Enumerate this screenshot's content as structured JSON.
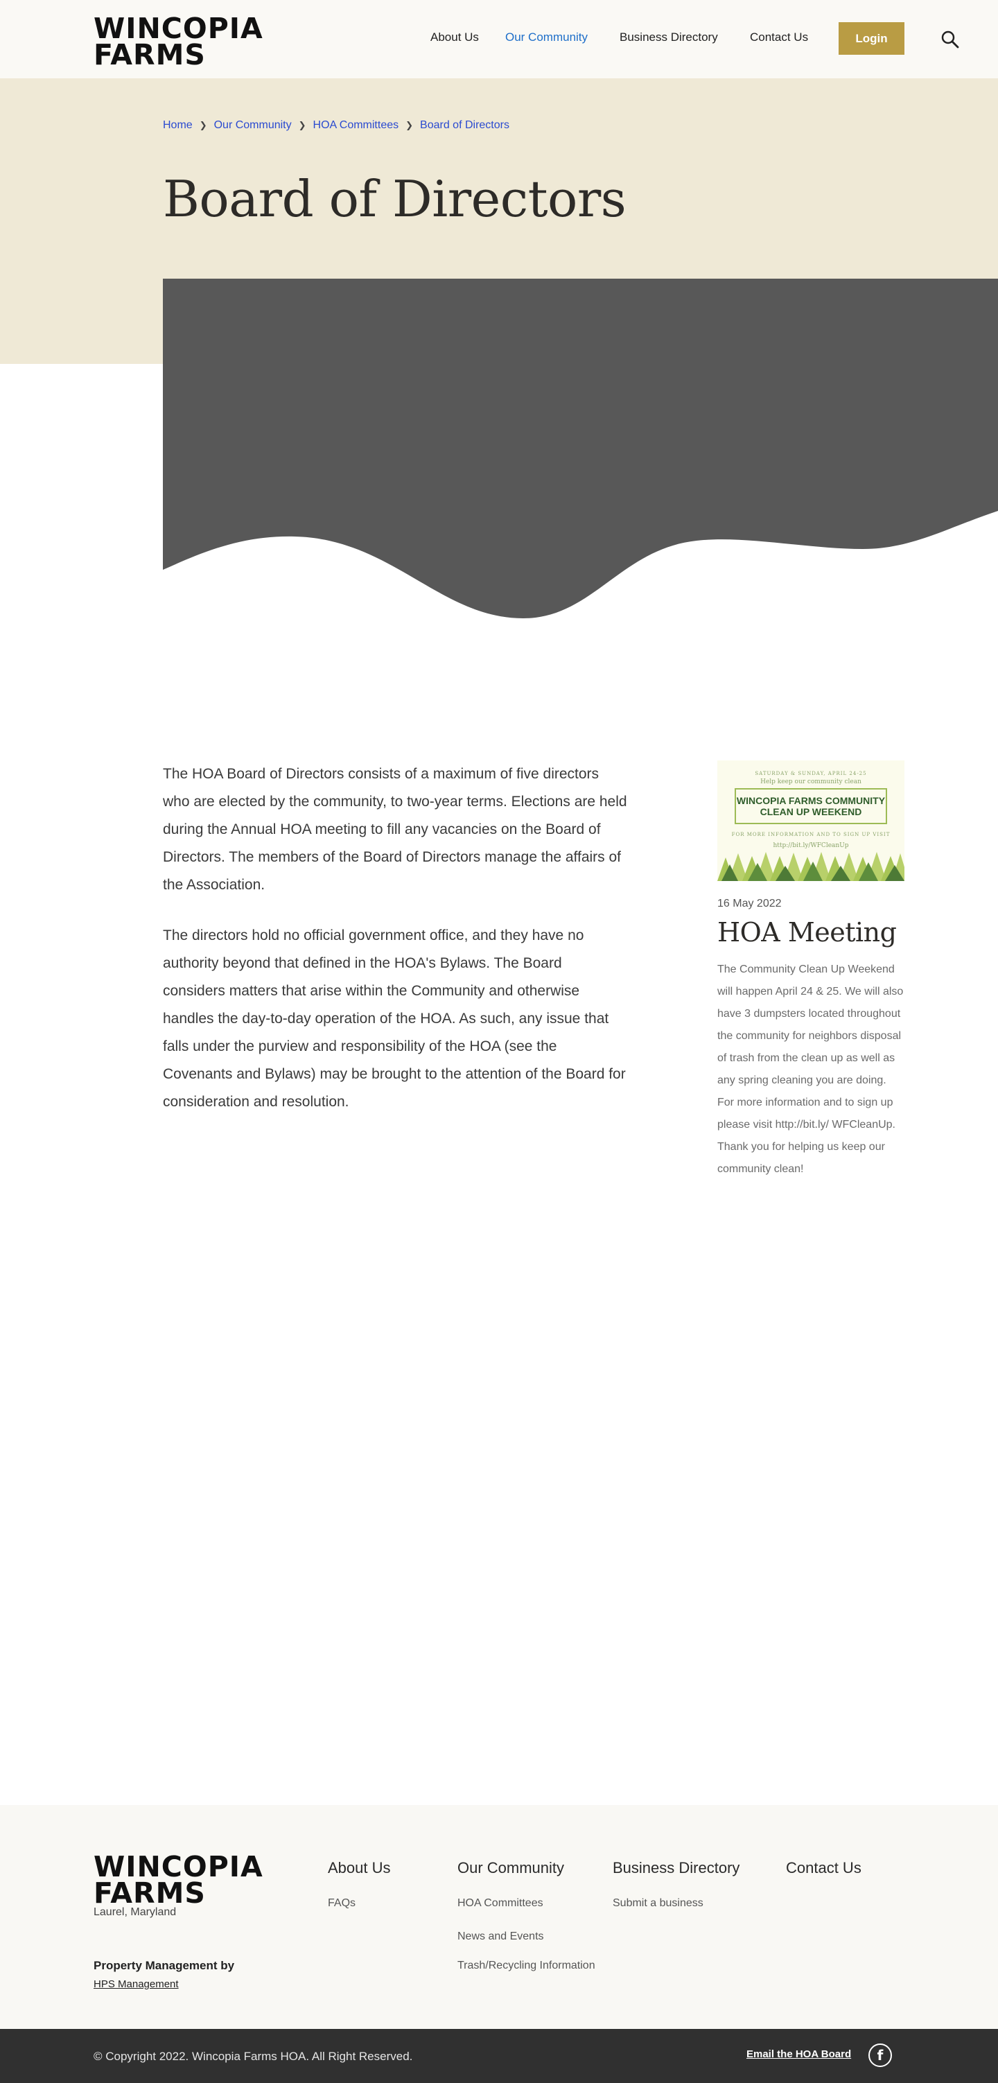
{
  "header": {
    "logo_line1": "WINCOPIA",
    "logo_line2": "FARMS",
    "nav": [
      {
        "label": "About Us"
      },
      {
        "label": "Our Community"
      },
      {
        "label": "Business Directory"
      },
      {
        "label": "Contact Us"
      }
    ],
    "login_label": "Login",
    "active_color": "#1e6fc9",
    "button_color": "#b99c44"
  },
  "breadcrumb": [
    "Home",
    "Our Community",
    "HOA Committees",
    "Board of Directors"
  ],
  "page_title": "Board of Directors",
  "body": {
    "paragraphs": [
      "The HOA Board of Directors consists of a maximum of five directors who are elected by the community, to two-year terms. Elections are held during the Annual HOA meeting to fill any vacancies on the Board of Directors. The members of the Board of Directors manage the affairs of the Association.",
      "The directors hold no official government office, and they have no authority beyond that defined in the HOA's Bylaws. The Board considers matters that arise within the Community and otherwise handles the day-to-day operation of the HOA. As such, any issue that falls under the purview and responsibility of the HOA (see the Covenants and Bylaws) may be brought to the attention of the Board for consideration and resolution."
    ]
  },
  "sidebar": {
    "image": {
      "top_line": "SATURDAY & SUNDAY, APRIL 24-25",
      "sub_line": "Help keep our community clean",
      "headline": "WINCOPIA FARMS COMMUNITY CLEAN UP WEEKEND",
      "info_line": "FOR MORE INFORMATION AND TO SIGN UP VISIT",
      "url_line": "http://bit.ly/WFCleanUp"
    },
    "date": "16 May 2022",
    "title": "HOA Meeting",
    "description": "The Community Clean Up Weekend will happen April 24 & 25. We will also have 3 dumpsters located throughout the community for neighbors disposal of trash from the clean up as well as any spring cleaning you are doing. For more information and to sign up please visit http://bit.ly/ WFCleanUp. Thank you for helping us keep our community clean!"
  },
  "footer": {
    "logo_line1": "WINCOPIA",
    "logo_line2": "FARMS",
    "location": "Laurel, Maryland",
    "pm_label": "Property Management by",
    "pm_link": "HPS Management",
    "columns": [
      {
        "heading": "About Us",
        "links": [
          "FAQs"
        ]
      },
      {
        "heading": "Our Community",
        "links": [
          "HOA Committees",
          "News and Events",
          "Trash/Recycling Information"
        ]
      },
      {
        "heading": "Business Directory",
        "links": [
          "Submit a business"
        ]
      },
      {
        "heading": "Contact Us",
        "links": []
      }
    ],
    "copyright": "© Copyright 2022. Wincopia Farms HOA. All Right Reserved.",
    "email_link": "Email the HOA Board",
    "facebook_icon": "facebook-icon"
  }
}
